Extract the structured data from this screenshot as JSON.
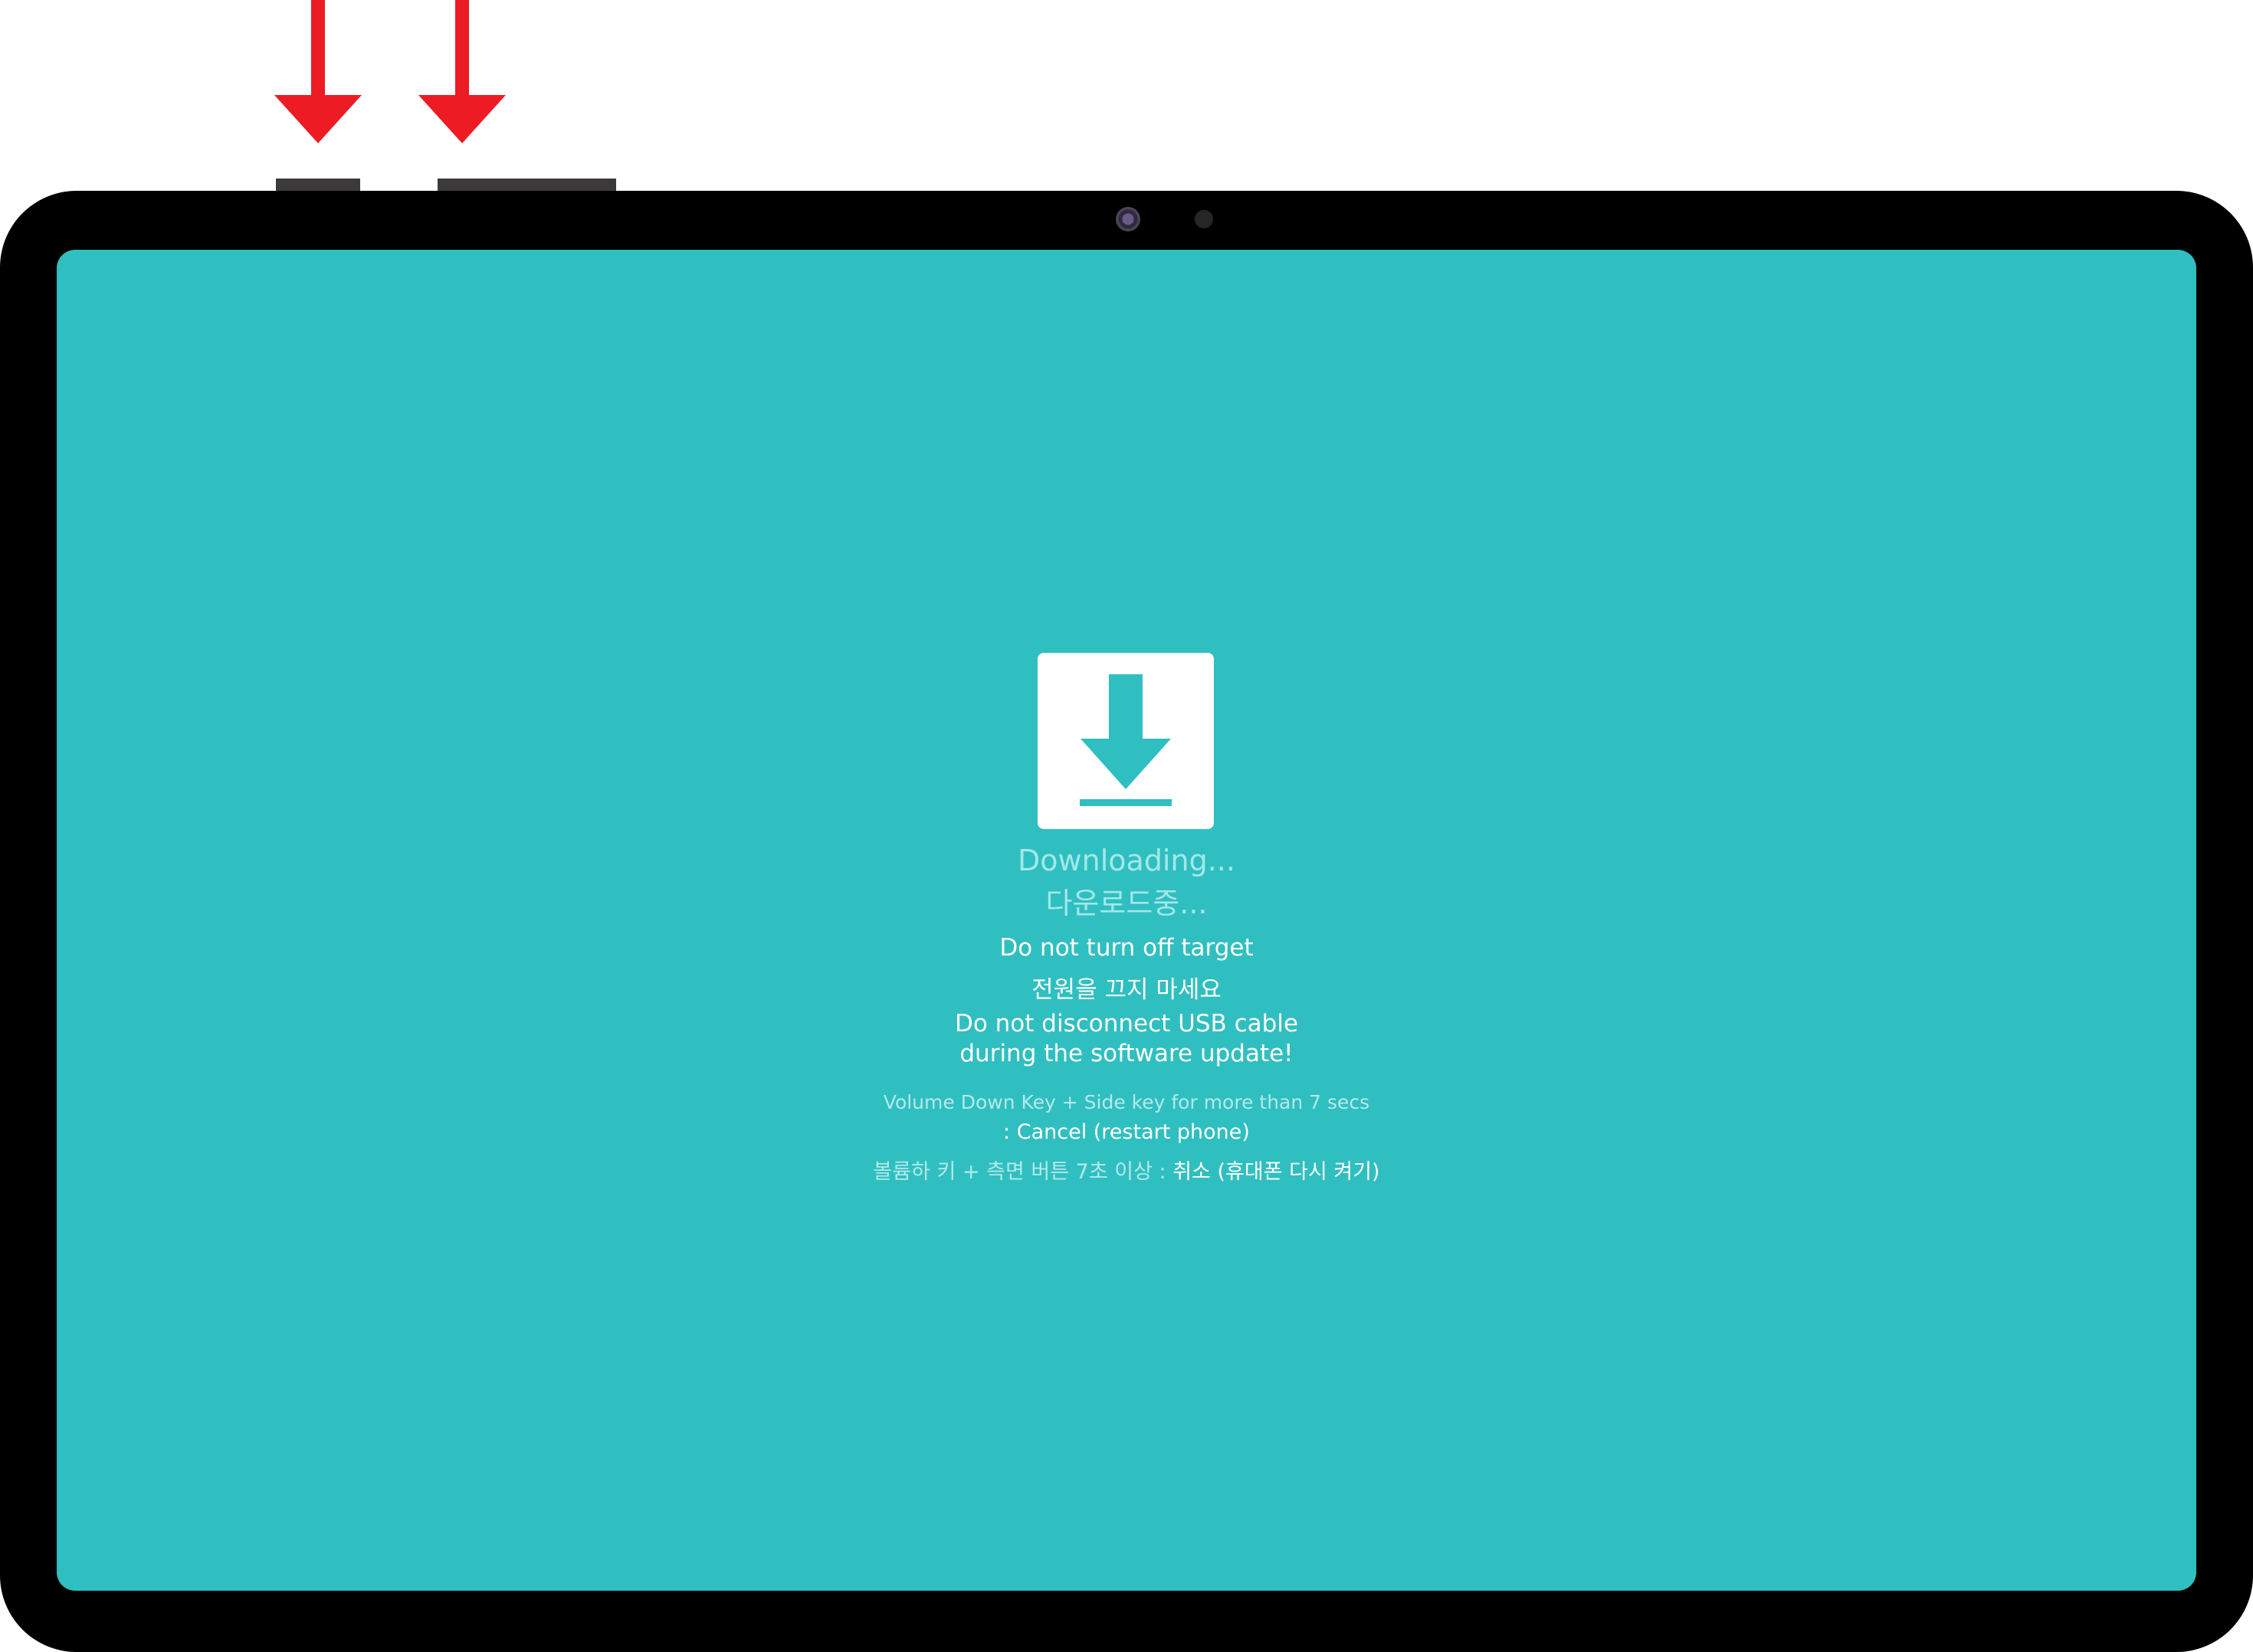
{
  "colors": {
    "screen_background": "#30bfc0",
    "tablet_bezel": "#000000",
    "hardware_buttons": "#3d3a3b",
    "annotation_arrows": "#ed1c24",
    "primary_text": "#ffffff",
    "muted_text": "#a3e7e8"
  },
  "annotations": {
    "arrows": [
      {
        "icon": "red-down-arrow-icon",
        "points_to": "volume-down-button"
      },
      {
        "icon": "red-down-arrow-icon",
        "points_to": "side-key-button"
      }
    ]
  },
  "screen": {
    "icon": "download-icon",
    "status": {
      "en": "Downloading...",
      "ko": "다운로드중..."
    },
    "warnings": {
      "power": "Do not turn off target",
      "power_ko": "전원을 끄지 마세요",
      "usb_line1": "Do not disconnect USB cable",
      "usb_line2": "during the software update!"
    },
    "cancel_instruction": {
      "combo_en": "Volume Down Key + Side key for more than 7 secs",
      "action_en": ": Cancel (restart phone)",
      "combo_ko": "볼륨하 키 + 측면 버튼 7초 이상 : ",
      "action_ko": "취소 (휴대폰 다시 켜기)"
    }
  }
}
